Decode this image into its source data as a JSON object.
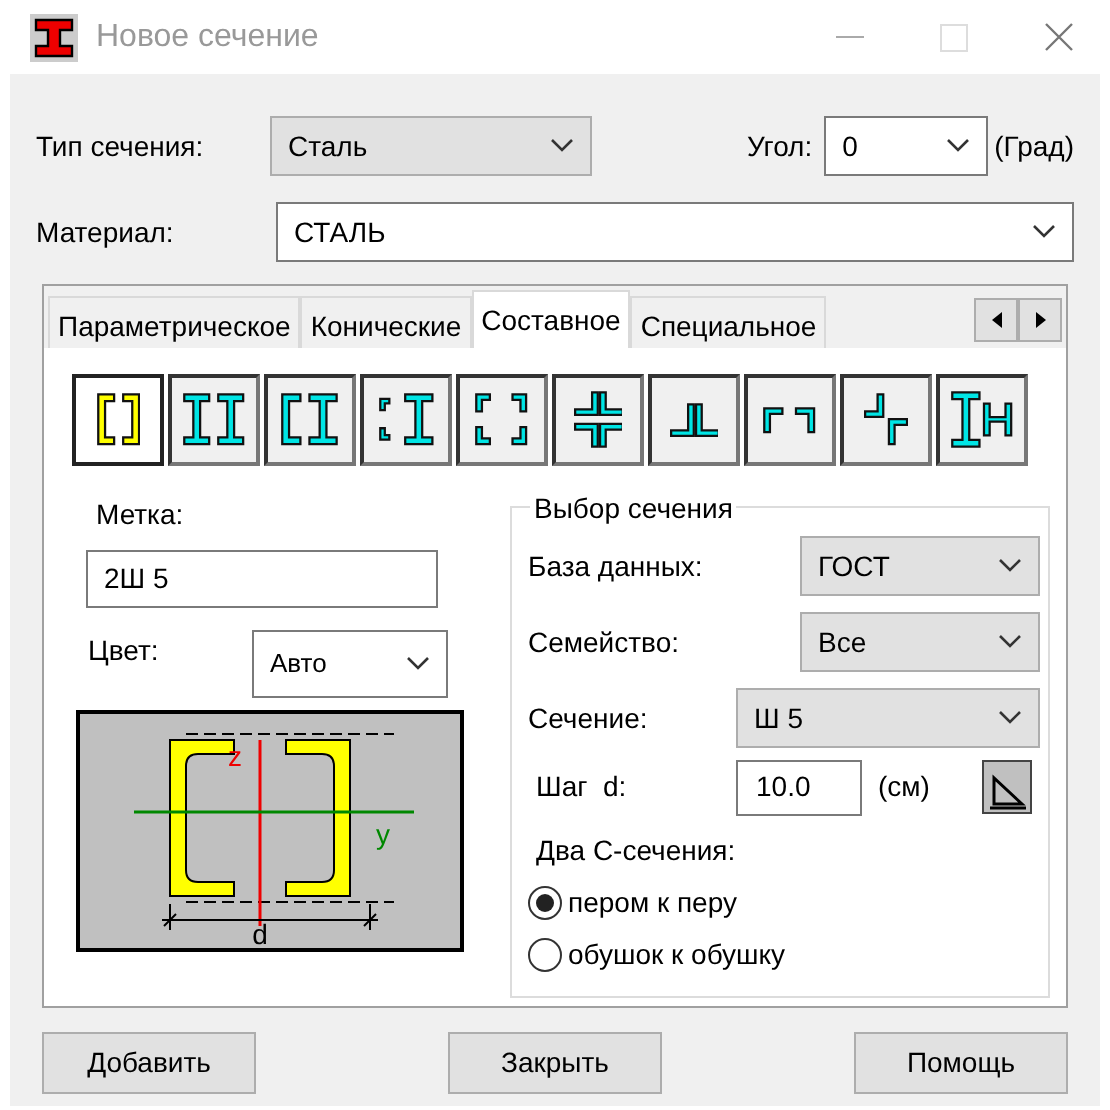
{
  "window": {
    "title": "Новое сечение"
  },
  "section_type": {
    "label": "Тип сечения:",
    "value": "Сталь"
  },
  "angle": {
    "label": "Угол:",
    "value": "0",
    "unit": "(Град)"
  },
  "material": {
    "label": "Материал:",
    "value": "СТАЛЬ"
  },
  "tabs": [
    {
      "label": "Параметрическое",
      "selected": false
    },
    {
      "label": "Конические",
      "selected": false
    },
    {
      "label": "Составное",
      "selected": true
    },
    {
      "label": "Специальное",
      "selected": false
    }
  ],
  "shape_buttons": [
    {
      "selected": true
    },
    {
      "selected": false
    },
    {
      "selected": false
    },
    {
      "selected": false
    },
    {
      "selected": false
    },
    {
      "selected": false
    },
    {
      "selected": false
    },
    {
      "selected": false
    },
    {
      "selected": false
    },
    {
      "selected": false
    }
  ],
  "mark": {
    "label": "Метка:",
    "value": "2Ш 5"
  },
  "color": {
    "label": "Цвет:",
    "value": "Авто"
  },
  "preview": {
    "axis_z": "z",
    "axis_y": "y",
    "dimension": "d"
  },
  "selection_group": {
    "title": "Выбор сечения",
    "database": {
      "label": "База данных:",
      "value": "ГОСТ"
    },
    "family": {
      "label": "Семейство:",
      "value": "Все"
    },
    "section": {
      "label": "Сечение:",
      "value": "Ш 5"
    },
    "step": {
      "label": "Шаг  d:",
      "value": "10.0",
      "unit": "(см)"
    },
    "two_c_label": "Два С-сечения:",
    "options": [
      {
        "label": "пером к перу",
        "selected": true
      },
      {
        "label": "обушок к обушку",
        "selected": false
      }
    ]
  },
  "buttons": [
    "Добавить",
    "Закрыть",
    "Помощь"
  ]
}
